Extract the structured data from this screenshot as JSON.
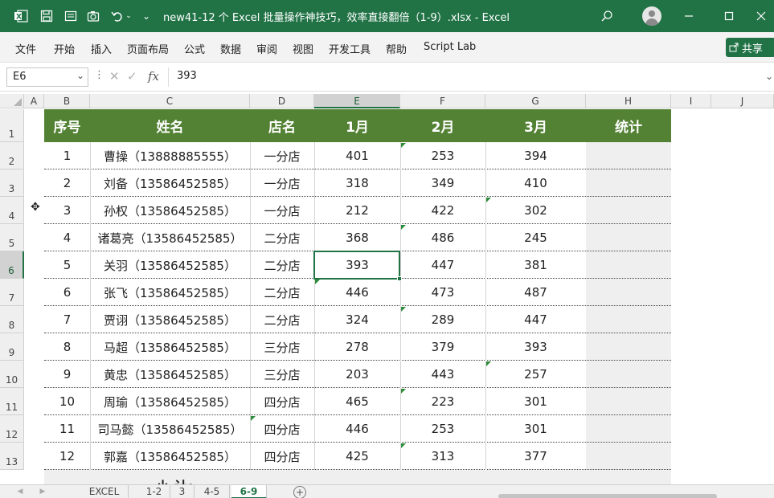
{
  "titlebar": {
    "title": "new41-12 个 Excel 批量操作神技巧，效率直接翻倍（1-9）.xlsx  -  Excel",
    "excel_icon": "excel-icon",
    "save_icon": "save-icon",
    "form_icon": "form-icon",
    "camera_icon": "camera-icon",
    "undo_icon": "undo-icon",
    "search_icon": "search-icon",
    "minimize_icon": "minimize-icon",
    "maximize_icon": "maximize-icon",
    "close_icon": "close-icon",
    "brand_color": "#217346"
  },
  "menu": [
    "文件",
    "开始",
    "插入",
    "页面布局",
    "公式",
    "数据",
    "审阅",
    "视图",
    "开发工具",
    "帮助",
    "Script Lab"
  ],
  "share_label": "共享",
  "namebox": "E6",
  "formula": "393",
  "columns": [
    "A",
    "B",
    "C",
    "D",
    "E",
    "F",
    "G",
    "H",
    "I",
    "J"
  ],
  "rows": [
    "1",
    "2",
    "3",
    "4",
    "5",
    "6",
    "7",
    "8",
    "9",
    "10",
    "11",
    "12",
    "13"
  ],
  "headers": [
    "序号",
    "姓名",
    "店名",
    "1月",
    "2月",
    "3月",
    "统计"
  ],
  "header_color": "#548235",
  "data": [
    [
      "1",
      "曹操（13888885555）",
      "一分店",
      "401",
      "253",
      "394"
    ],
    [
      "2",
      "刘备（13586452585）",
      "一分店",
      "318",
      "349",
      "410"
    ],
    [
      "3",
      "孙权（13586452585）",
      "一分店",
      "212",
      "422",
      "302"
    ],
    [
      "4",
      "诸葛亮（13586452585）",
      "二分店",
      "368",
      "486",
      "245"
    ],
    [
      "5",
      "关羽（13586452585）",
      "二分店",
      "393",
      "447",
      "381"
    ],
    [
      "6",
      "张飞（13586452585）",
      "二分店",
      "446",
      "473",
      "487"
    ],
    [
      "7",
      "贾诩（13586452585）",
      "二分店",
      "324",
      "289",
      "447"
    ],
    [
      "8",
      "马超（13586452585）",
      "三分店",
      "278",
      "379",
      "393"
    ],
    [
      "9",
      "黄忠（13586452585）",
      "三分店",
      "203",
      "443",
      "257"
    ],
    [
      "10",
      "周瑜（13586452585）",
      "四分店",
      "465",
      "223",
      "301"
    ],
    [
      "11",
      "司马懿（13586452585）",
      "四分店",
      "446",
      "253",
      "301"
    ],
    [
      "12",
      "郭嘉（13586452585）",
      "四分店",
      "425",
      "313",
      "377"
    ]
  ],
  "subtotal_label": "小 计:",
  "sheet_tabs": [
    "EXCEL",
    "1-2",
    "3",
    "4-5",
    "6-9"
  ],
  "active_tab": "6-9"
}
